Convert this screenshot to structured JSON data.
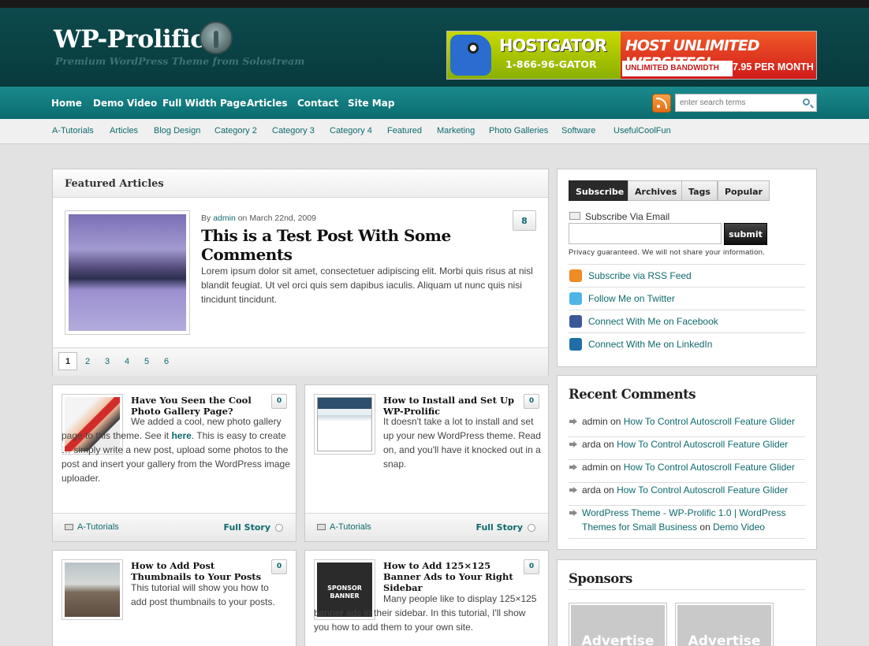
{
  "site": {
    "logo_text": "WP-Prolific",
    "tagline": "Premium WordPress Theme from Solostream"
  },
  "banner": {
    "brand": "HOSTGATOR",
    "phone": "1-866-96-GATOR",
    "headline": "HOST UNLIMITED WEBSITES!",
    "bandwidth": "UNLIMITED BANDWIDTH",
    "price": "$7.95 PER MONTH"
  },
  "nav": {
    "items": [
      "Home",
      "Demo Video",
      "Full Width Page",
      "Articles",
      "Contact",
      "Site Map"
    ],
    "search_placeholder": "enter search terms",
    "rss_icon": "rss-icon",
    "search_icon": "search-icon"
  },
  "categories": [
    "A-Tutorials",
    "Articles",
    "Blog Design",
    "Category 2",
    "Category 3",
    "Category 4",
    "Featured",
    "Marketing",
    "Photo Galleries",
    "Software",
    "UsefulCoolFun"
  ],
  "featured": {
    "heading": "Featured Articles",
    "by_prefix": "By",
    "author": "admin",
    "date_text": "on March 22nd, 2009",
    "title": "This is a Test Post With Some Comments",
    "excerpt": "Lorem ipsum dolor sit amet, consectetuer adipiscing elit. Morbi quis risus at nisl blandit feugiat. Ut vel orci quis sem dapibus iaculis. Aliquam ut nunc quis nisi tincidunt tincidunt.",
    "comments": "8",
    "pages": [
      "1",
      "2",
      "3",
      "4",
      "5",
      "6"
    ]
  },
  "posts": [
    {
      "title": "Have You Seen the Cool Photo Gallery Page?",
      "comments": "0",
      "text_a": "We added a cool, new photo gallery page to this theme. See it",
      "link": "here",
      "text_b": ". This is easy to create … simply write a new post, upload some photos to the post and insert your gallery from the WordPress image uploader.",
      "category": "A-Tutorials",
      "full_story": "Full Story"
    },
    {
      "title": "How to Install and Set Up WP-Prolific",
      "comments": "0",
      "text": "It doesn't take a lot to install and set up your new WordPress theme. Read on, and you'll have it knocked out in a snap.",
      "category": "A-Tutorials",
      "full_story": "Full Story"
    },
    {
      "title": "How to Add Post Thumbnails to Your Posts",
      "comments": "0",
      "text": "This tutorial will show you how to add post thumbnails to your posts."
    },
    {
      "title": "How to Add 125×125 Banner Ads to Your Right Sidebar",
      "comments": "0",
      "thumb_text": "SPONSOR BANNER",
      "text": "Many people like to display 125×125 banner ads in their sidebar. In this tutorial, I'll show you how to add them to your own site."
    }
  ],
  "sidebar": {
    "tabs": [
      "Subscribe",
      "Archives",
      "Tags",
      "Popular"
    ],
    "subscribe_label": "Subscribe Via Email",
    "submit_label": "submit",
    "privacy": "Privacy guaranteed. We will not share your information.",
    "social": [
      {
        "label": "Subscribe via RSS Feed",
        "icon": "rss-icon",
        "color": "#f08a24"
      },
      {
        "label": "Follow Me on Twitter",
        "icon": "twitter-icon",
        "color": "#4fb5e6"
      },
      {
        "label": "Connect With Me on Facebook",
        "icon": "facebook-icon",
        "color": "#3b5998"
      },
      {
        "label": "Connect With Me on LinkedIn",
        "icon": "linkedin-icon",
        "color": "#1f6ea8"
      }
    ],
    "recent_heading": "Recent Comments",
    "recent": [
      {
        "author": "admin",
        "on": "on",
        "post": "How To Control Autoscroll Feature Glider"
      },
      {
        "author": "arda",
        "on": "on",
        "post": "How To Control Autoscroll Feature Glider"
      },
      {
        "author": "admin",
        "on": "on",
        "post": "How To Control Autoscroll Feature Glider"
      },
      {
        "author": "arda",
        "on": "on",
        "post": "How To Control Autoscroll Feature Glider"
      },
      {
        "author": "WordPress Theme - WP-Prolific 1.0 | WordPress Themes for Small Business",
        "on": "on",
        "post": "Demo Video"
      }
    ],
    "sponsors_heading": "Sponsors",
    "ads": [
      "Advertise",
      "Advertise"
    ]
  },
  "colors": {
    "accent": "#0f6a6e",
    "header": "#0a4245",
    "nav": "#137a7d"
  }
}
